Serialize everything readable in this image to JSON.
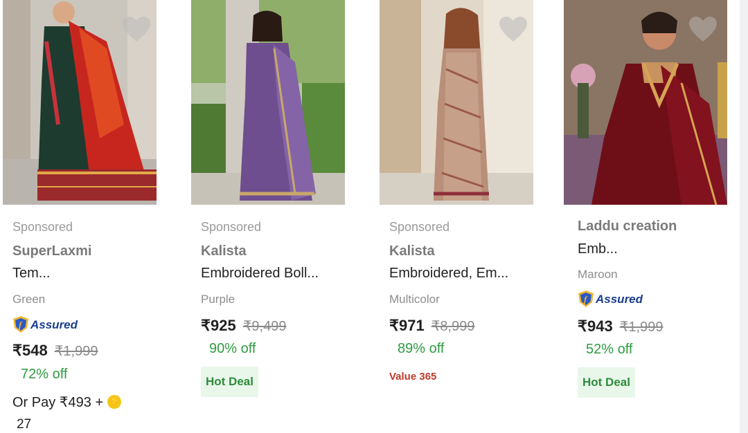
{
  "products": [
    {
      "sponsored": "Sponsored",
      "brand": "SuperLaxmi",
      "title": "Tem...",
      "color": "Green",
      "assured_label": "Assured",
      "price": "₹548",
      "mrp": "₹1,999",
      "discount": "72% off",
      "pay_offer": "Or Pay ₹493 +",
      "pay_offer_points": "27",
      "wishlist_icon": "heart-icon"
    },
    {
      "sponsored": "Sponsored",
      "brand": "Kalista",
      "title": "Embroidered Boll...",
      "color": "Purple",
      "price": "₹925",
      "mrp": "₹9,499",
      "discount": "90% off",
      "deal_badge": "Hot Deal",
      "wishlist_icon": "heart-icon"
    },
    {
      "sponsored": "Sponsored",
      "brand": "Kalista",
      "title": "Embroidered, Em...",
      "color": "Multicolor",
      "price": "₹971",
      "mrp": "₹8,999",
      "discount": "89% off",
      "value_tag": "Value 365",
      "wishlist_icon": "heart-icon"
    },
    {
      "brand": "Laddu creation",
      "title": "Emb...",
      "color": "Maroon",
      "assured_label": "Assured",
      "price": "₹943",
      "mrp": "₹1,999",
      "discount": "52% off",
      "deal_badge": "Hot Deal",
      "wishlist_icon": "heart-icon"
    }
  ],
  "colors": {
    "discount_green": "#2e9b41",
    "assured_blue": "#1a3d8f",
    "value_red": "#c0392b",
    "deal_bg": "#e9f7ea"
  }
}
